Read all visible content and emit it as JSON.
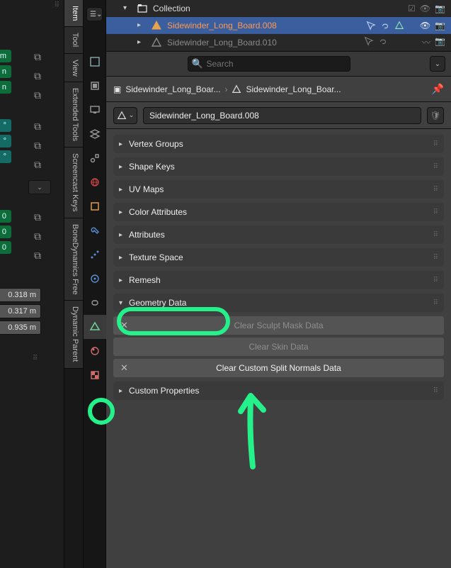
{
  "left_strip": {
    "green_buttons": [
      "m",
      "n",
      "n"
    ],
    "teal_buttons": [
      "°",
      "°",
      "°"
    ],
    "green_boxes": [
      "0",
      "0",
      "0"
    ],
    "dim_labels": [
      "0.318 m",
      "0.317 m",
      "0.935 m"
    ]
  },
  "tab_rail": [
    {
      "label": "Item",
      "active": true
    },
    {
      "label": "Tool",
      "active": false
    },
    {
      "label": "View",
      "active": false
    },
    {
      "label": "Extended Tools",
      "active": false
    },
    {
      "label": "Screencast Keys",
      "active": false
    },
    {
      "label": "BoneDynamics Free",
      "active": false
    },
    {
      "label": "Dynamic Parent",
      "active": false
    }
  ],
  "prop_icons": [
    "tool",
    "render",
    "output",
    "view-layer",
    "scene",
    "world",
    "object",
    "modifier",
    "particles",
    "physics",
    "constraint",
    "mesh-data",
    "material",
    "texture"
  ],
  "prop_active_index": 11,
  "outliner": {
    "collection_label": "Collection",
    "items": [
      {
        "name": "Sidewinder_Long_Board.008",
        "active": true,
        "visible": true
      },
      {
        "name": "Sidewinder_Long_Board.010",
        "active": false,
        "visible": true
      }
    ]
  },
  "search": {
    "placeholder": "Search"
  },
  "breadcrumb": {
    "scene": "Sidewinder_Long_Boar...",
    "mesh": "Sidewinder_Long_Boar..."
  },
  "mesh_name": "Sidewinder_Long_Board.008",
  "panels": [
    {
      "title": "Vertex Groups",
      "expanded": false
    },
    {
      "title": "Shape Keys",
      "expanded": false
    },
    {
      "title": "UV Maps",
      "expanded": false
    },
    {
      "title": "Color Attributes",
      "expanded": false
    },
    {
      "title": "Attributes",
      "expanded": false
    },
    {
      "title": "Texture Space",
      "expanded": false
    },
    {
      "title": "Remesh",
      "expanded": false
    }
  ],
  "geometry_panel": {
    "title": "Geometry Data",
    "expanded": true,
    "buttons": [
      {
        "label": "Clear Sculpt Mask Data",
        "enabled": false
      },
      {
        "label": "Clear Skin Data",
        "enabled": false
      },
      {
        "label": "Clear Custom Split Normals Data",
        "enabled": true
      }
    ]
  },
  "custom_props_panel": {
    "title": "Custom Properties"
  }
}
